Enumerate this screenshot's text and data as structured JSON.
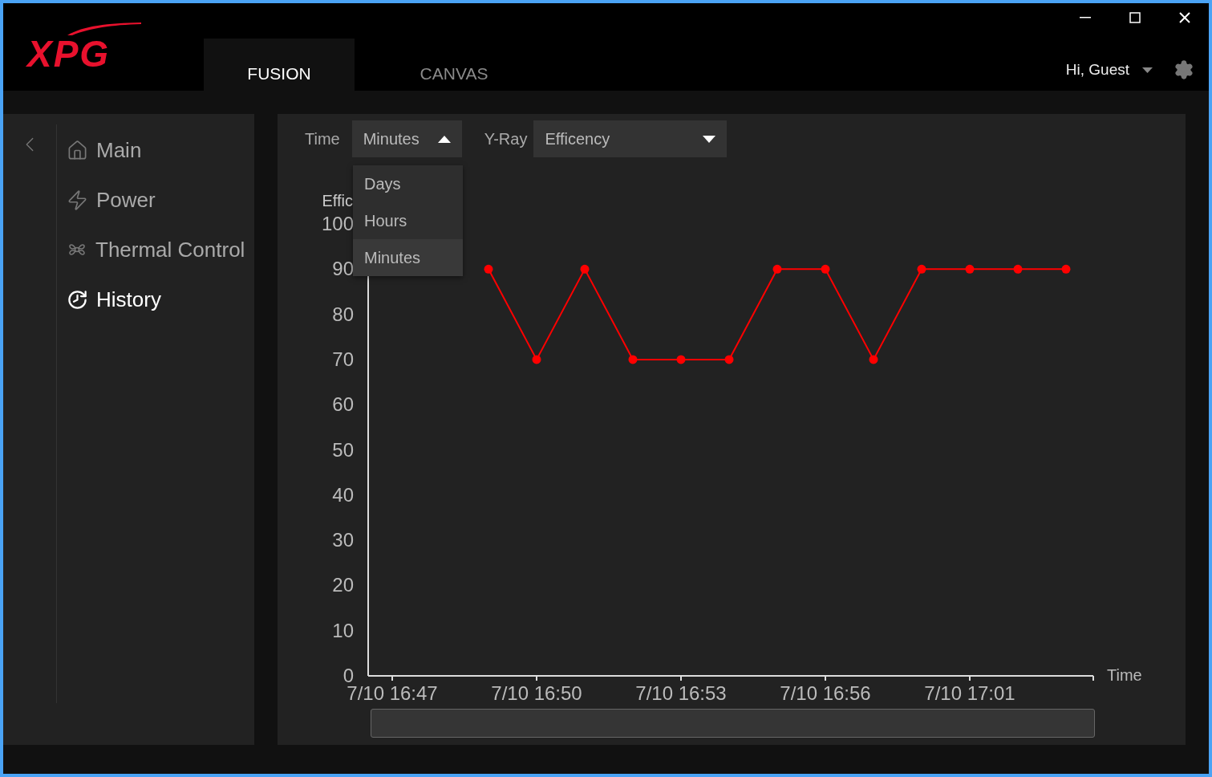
{
  "header": {
    "logo": "XPG",
    "tabs": [
      {
        "label": "FUSION",
        "selected": true
      },
      {
        "label": "CANVAS",
        "selected": false
      }
    ],
    "user": "Hi, Guest"
  },
  "sidebar": {
    "items": [
      {
        "label": "Main",
        "kind": "home",
        "selected": false
      },
      {
        "label": "Power",
        "kind": "bolt",
        "selected": false
      },
      {
        "label": "Thermal Control",
        "kind": "fan",
        "selected": false
      },
      {
        "label": "History",
        "kind": "clock",
        "selected": true
      }
    ]
  },
  "toolbar": {
    "time_label": "Time",
    "time_select": {
      "value": "Minutes",
      "expanded": true,
      "options": [
        {
          "label": "Days",
          "selected": false
        },
        {
          "label": "Hours",
          "selected": false
        },
        {
          "label": "Minutes",
          "selected": true
        }
      ]
    },
    "y_label": "Y-Ray",
    "y_select": {
      "value": "Efficency",
      "expanded": false
    }
  },
  "chart_data": {
    "type": "line",
    "xlabel": "Time",
    "ylabel": "Effic",
    "categories": [
      "7/10 16:47",
      null,
      null,
      "7/10 16:50",
      null,
      null,
      "7/10 16:53",
      null,
      null,
      "7/10 16:56",
      null,
      null,
      "7/10 17:01",
      null,
      null
    ],
    "series": [
      {
        "color": "#ff0000",
        "marker": "circle",
        "values": [
          null,
          null,
          90,
          70,
          90,
          70,
          70,
          70,
          90,
          90,
          70,
          90,
          90,
          90,
          90
        ]
      }
    ],
    "ylim": [
      0,
      100
    ],
    "yticks": [
      0,
      10,
      20,
      30,
      40,
      50,
      60,
      70,
      80,
      90,
      100
    ]
  }
}
